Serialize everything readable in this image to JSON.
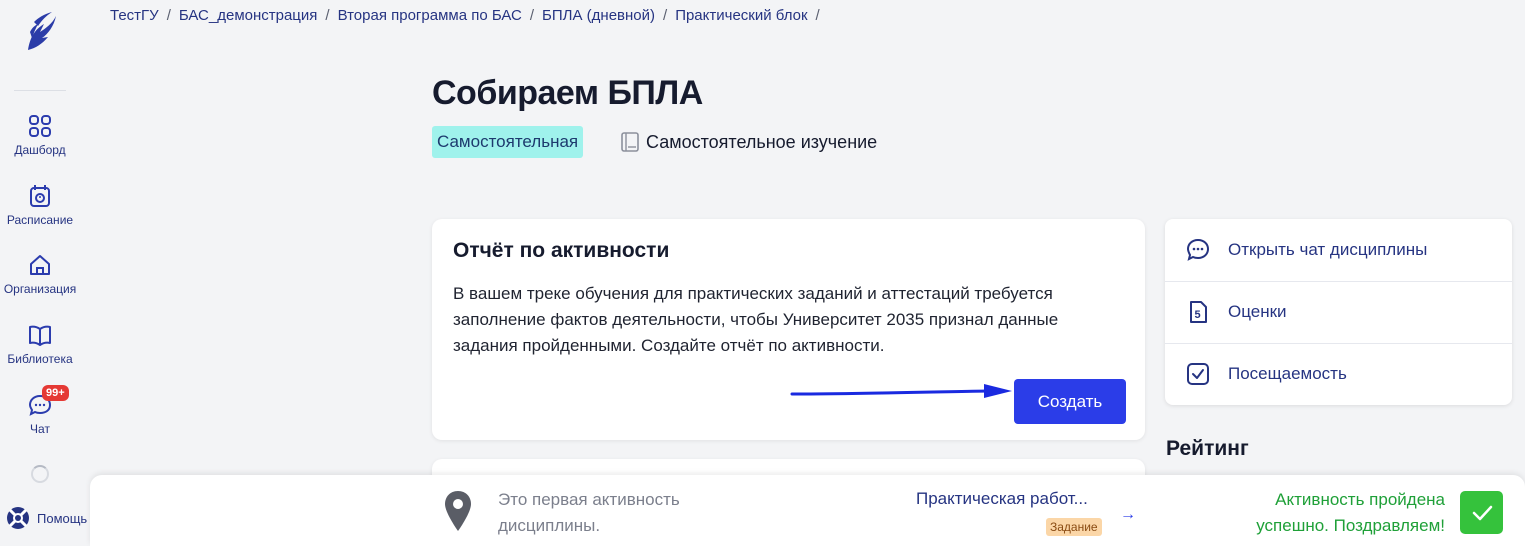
{
  "breadcrumb": [
    "ТестГУ",
    "БАС_демонстрация",
    "Вторая программа по БАС",
    "БПЛА (дневной)",
    "Практический блок"
  ],
  "sidebar": {
    "items": [
      {
        "label": "Дашборд",
        "icon": "grid-icon"
      },
      {
        "label": "Расписание",
        "icon": "calendar-icon"
      },
      {
        "label": "Организация",
        "icon": "home-icon"
      },
      {
        "label": "Библиотека",
        "icon": "book-icon"
      },
      {
        "label": "Чат",
        "icon": "chat-icon",
        "badge": "99+"
      }
    ],
    "help_label": "Помощь"
  },
  "page": {
    "title": "Собираем БПЛА",
    "type_badge": "Самостоятельная",
    "study_type": "Самостоятельное изучение"
  },
  "activity_card": {
    "title": "Отчёт по активности",
    "text": "В вашем треке обучения для практических заданий и аттестаций требуется заполнение фактов деятельности, чтобы Университет 2035 признал данные задания пройденными. Создайте отчёт по активности.",
    "button_label": "Создать"
  },
  "right_panel": {
    "items": [
      {
        "label": "Открыть чат дисциплины",
        "icon": "chat-bubble-icon"
      },
      {
        "label": "Оценки",
        "icon": "grade-icon"
      },
      {
        "label": "Посещаемость",
        "icon": "checkbox-icon"
      }
    ]
  },
  "rating_title": "Рейтинг",
  "bottom_bar": {
    "first_note": "Это первая активность дисциплины.",
    "next_activity": "Практическая работ...",
    "next_tag": "Задание",
    "success_msg": "Активность пройдена успешно. Поздравляем!"
  },
  "colors": {
    "accent": "#2b3de8",
    "nav_text": "#263482",
    "badge_bg": "#9ff2ec",
    "success": "#1fa038",
    "check_bg": "#35c23c"
  }
}
